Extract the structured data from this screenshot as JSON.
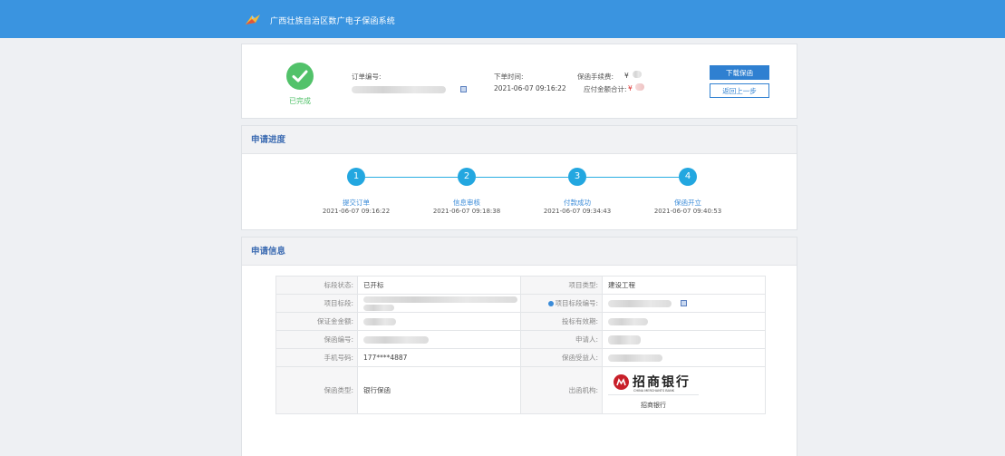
{
  "app": {
    "title": "广西壮族自治区数广电子保函系统"
  },
  "order": {
    "status": "已完成",
    "order_no_label": "订单编号:",
    "order_time_label": "下单时间:",
    "order_time": "2021-06-07 09:16:22",
    "fee_label": "保函手续费:",
    "fee_currency": "¥",
    "total_label": "应付金额合计:",
    "total_currency": "¥",
    "download_button": "下载保函",
    "back_button": "返回上一步"
  },
  "progress": {
    "title": "申请进度",
    "steps": [
      {
        "number": "1",
        "label": "提交订单",
        "time": "2021-06-07 09:16:22"
      },
      {
        "number": "2",
        "label": "信息审核",
        "time": "2021-06-07 09:18:38"
      },
      {
        "number": "3",
        "label": "付款成功",
        "time": "2021-06-07 09:34:43"
      },
      {
        "number": "4",
        "label": "保函开立",
        "time": "2021-06-07 09:40:53"
      }
    ]
  },
  "info": {
    "title": "申请信息",
    "bid_status_label": "标段状态:",
    "bid_status": "已开标",
    "project_type_label": "项目类型:",
    "project_type": "建设工程",
    "section_label": "项目标段:",
    "section_no_label": "项目标段编号:",
    "deposit_label": "保证金金额:",
    "validity_label": "投标有效期:",
    "guarantee_no_label": "保函编号:",
    "applicant_label": "申请人:",
    "phone_label": "手机号码:",
    "phone": "177****4887",
    "beneficiary_label": "保函受益人:",
    "guarantee_type_label": "保函类型:",
    "guarantee_type": "银行保函",
    "issuer_label": "出函机构:",
    "bank_logo_text": "招商银行",
    "bank_logo_en": "CHINA MERCHANTS BANK",
    "bank_name": "招商银行"
  },
  "colors": {
    "header": "#3a94e0",
    "success": "#52c26a",
    "step": "#23a7e0",
    "bank": "#c8202a"
  }
}
